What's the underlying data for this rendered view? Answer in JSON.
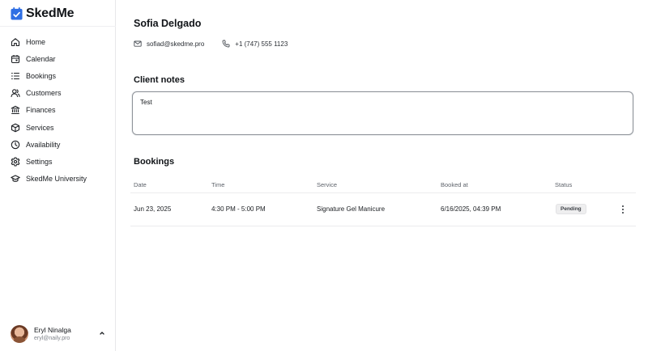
{
  "app": {
    "name": "SkedMe",
    "accent": "#2f6fe4"
  },
  "nav": {
    "items": [
      {
        "label": "Home",
        "icon": "home-icon"
      },
      {
        "label": "Calendar",
        "icon": "calendar-icon"
      },
      {
        "label": "Bookings",
        "icon": "list-icon"
      },
      {
        "label": "Customers",
        "icon": "users-icon"
      },
      {
        "label": "Finances",
        "icon": "bank-icon"
      },
      {
        "label": "Services",
        "icon": "box-icon"
      },
      {
        "label": "Availability",
        "icon": "clock-icon"
      },
      {
        "label": "Settings",
        "icon": "gear-icon"
      },
      {
        "label": "SkedMe University",
        "icon": "graduation-cap-icon"
      }
    ]
  },
  "user": {
    "name": "Eryl Ninalga",
    "email": "eryl@naily.pro"
  },
  "client": {
    "name": "Sofia Delgado",
    "email": "sofiad@skedme.pro",
    "phone": "+1 (747) 555 1123"
  },
  "notes": {
    "title": "Client notes",
    "value": "Test"
  },
  "bookings": {
    "title": "Bookings",
    "columns": [
      "Date",
      "Time",
      "Service",
      "Booked at",
      "Status"
    ],
    "rows": [
      {
        "date": "Jun 23, 2025",
        "time": "4:30 PM - 5:00 PM",
        "service": "Signature Gel Manicure",
        "booked_at": "6/16/2025, 04:39 PM",
        "status": "Pending"
      }
    ]
  }
}
